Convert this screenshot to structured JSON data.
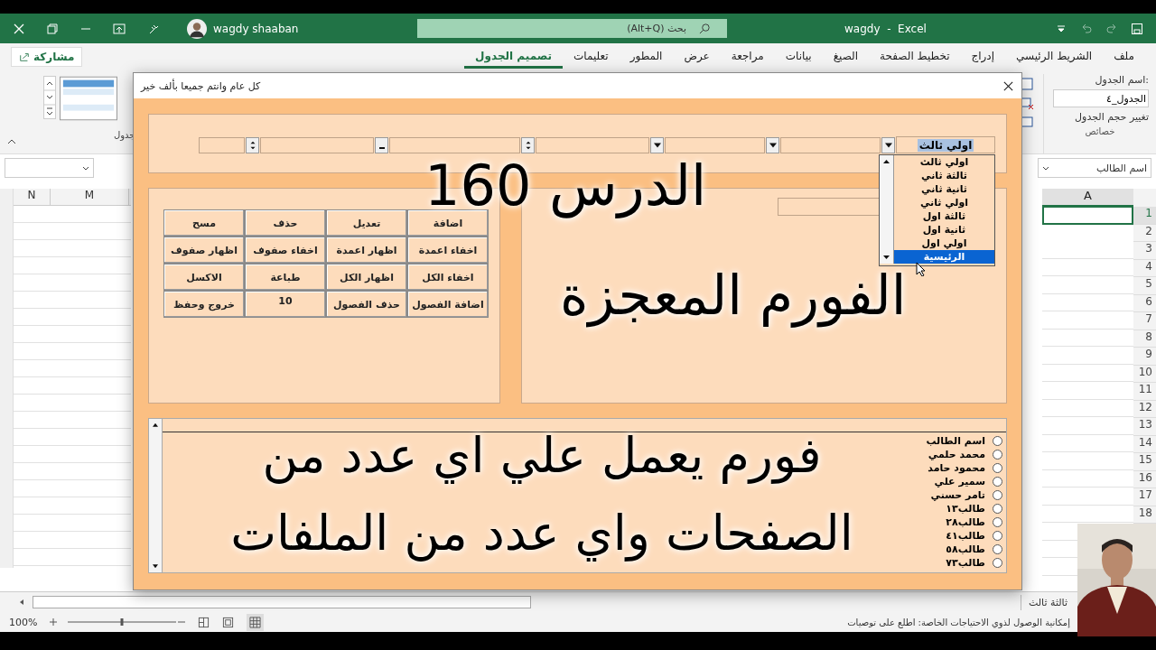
{
  "window": {
    "title": "wagdy  -  Excel",
    "user": "wagdy shaaban",
    "search_placeholder": "بحث (Alt+Q)"
  },
  "ribbon_tabs": [
    {
      "label": "ملف",
      "selected": false
    },
    {
      "label": "الشريط الرئيسي",
      "selected": false
    },
    {
      "label": "إدراج",
      "selected": false
    },
    {
      "label": "تخطيط الصفحة",
      "selected": false
    },
    {
      "label": "الصيغ",
      "selected": false
    },
    {
      "label": "بيانات",
      "selected": false
    },
    {
      "label": "مراجعة",
      "selected": false
    },
    {
      "label": "عرض",
      "selected": false
    },
    {
      "label": "المطور",
      "selected": false
    },
    {
      "label": "تعليمات",
      "selected": false
    },
    {
      "label": "تصميم الجدول",
      "selected": true
    }
  ],
  "share_button": "مشاركة",
  "properties": {
    "name_label": "اسم الجدول:",
    "name_value": "الجدول_٤",
    "resize": "تغيير حجم الجدول",
    "group": "خصائص"
  },
  "styles_group": "جدول",
  "name_box": "اسم الطالب",
  "column_headers_left": [
    "M",
    "N"
  ],
  "column_header_right": "A",
  "row_numbers": [
    "1",
    "2",
    "3",
    "4",
    "5",
    "6",
    "7",
    "8",
    "9",
    "10",
    "11",
    "12",
    "13",
    "14",
    "15",
    "16",
    "17",
    "18"
  ],
  "dialog": {
    "title": "كل عام وانتم جميعا بألف خير",
    "combo_value": "اولي ثالث",
    "dropdown": [
      {
        "label": "اولي ثالث",
        "selected": false
      },
      {
        "label": "ثالثة ثاني",
        "selected": false
      },
      {
        "label": "ثانية ثاني",
        "selected": false
      },
      {
        "label": "اولي ثاني",
        "selected": false
      },
      {
        "label": "ثالثة اول",
        "selected": false
      },
      {
        "label": "ثانية اول",
        "selected": false
      },
      {
        "label": "اولي اول",
        "selected": false
      },
      {
        "label": "الرئيسية",
        "selected": true
      }
    ],
    "buttons": [
      {
        "kind": "button",
        "label": "اضافة"
      },
      {
        "kind": "button",
        "label": "تعديل"
      },
      {
        "kind": "button",
        "label": "حذف"
      },
      {
        "kind": "button",
        "label": "مسح"
      },
      {
        "kind": "button",
        "label": "اخفاء اعمدة"
      },
      {
        "kind": "button",
        "label": "اظهار اعمدة"
      },
      {
        "kind": "button",
        "label": "اخفاء صفوف"
      },
      {
        "kind": "button",
        "label": "اظهار صفوف"
      },
      {
        "kind": "button",
        "label": "اخفاء الكل"
      },
      {
        "kind": "button",
        "label": "اظهار الكل"
      },
      {
        "kind": "button",
        "label": "طباعة"
      },
      {
        "kind": "button",
        "label": "الاكسل"
      },
      {
        "kind": "button",
        "label": "اضافة الفصول"
      },
      {
        "kind": "button",
        "label": "حذف الفصول"
      },
      {
        "kind": "field",
        "label": "10"
      },
      {
        "kind": "button",
        "label": "خروج وحفظ"
      }
    ],
    "students": [
      {
        "label": "اسم الطالب",
        "selected": false
      },
      {
        "label": "محمد حلمي",
        "selected": false
      },
      {
        "label": "محمود حامد",
        "selected": false
      },
      {
        "label": "سمير علي",
        "selected": false
      },
      {
        "label": "تامر حسني",
        "selected": false
      },
      {
        "label": "طالب١٣",
        "selected": false
      },
      {
        "label": "طالب٢٨",
        "selected": false
      },
      {
        "label": "طالب٤١",
        "selected": false
      },
      {
        "label": "طالب٥٨",
        "selected": false
      },
      {
        "label": "طالب٧٣",
        "selected": false
      }
    ]
  },
  "overlay": {
    "lesson": "الدرس 160",
    "headline": "الفورم المعجزة",
    "caption": [
      "فورم يعمل علي اي عدد من",
      "الصفحات واي عدد من الملفات"
    ]
  },
  "sheet_tabs": [
    {
      "label": "ثالثة ثالث",
      "selected": false
    }
  ],
  "status_bar": {
    "zoom": "100%",
    "zoom_slider": {
      "level": 0.5
    },
    "accessibility": "إمكانية الوصول لذوي الاحتياجات الخاصة: اطلع على توصيات"
  }
}
